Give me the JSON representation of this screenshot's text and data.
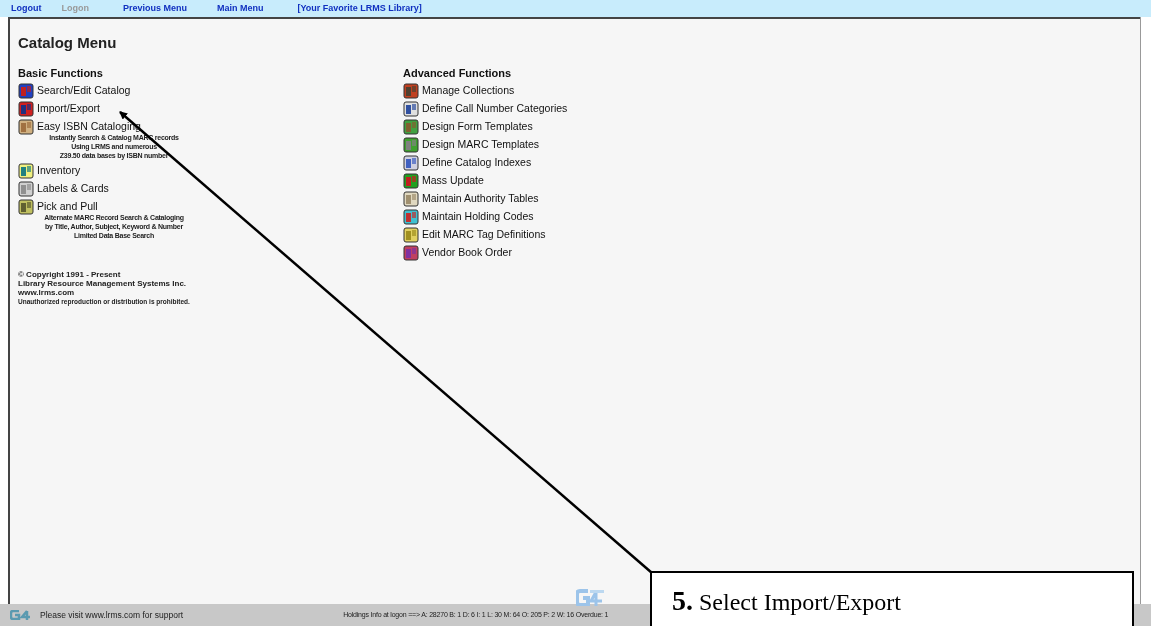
{
  "top_nav": [
    {
      "label": "Logout",
      "disabled": false
    },
    {
      "label": "Logon",
      "disabled": true
    },
    {
      "label": "Previous Menu",
      "disabled": false
    },
    {
      "label": "Main Menu",
      "disabled": false
    },
    {
      "label": "[Your Favorite LRMS Library]",
      "disabled": false
    }
  ],
  "page_title": "Catalog Menu",
  "basic_functions": {
    "heading": "Basic Functions",
    "items": [
      {
        "label": "Search/Edit Catalog"
      },
      {
        "label": "Import/Export"
      },
      {
        "label": "Easy ISBN Cataloging",
        "description": [
          "Instantly Search & Catalog MARC records",
          "Using LRMS and numerous",
          "Z39.50 data bases by ISBN number"
        ]
      },
      {
        "label": "Inventory"
      },
      {
        "label": "Labels & Cards"
      },
      {
        "label": "Pick and Pull",
        "description": [
          "Alternate MARC Record Search & Cataloging",
          "by Title, Author, Subject, Keyword & Number",
          "Limited Data Base Search"
        ]
      }
    ]
  },
  "copyright": [
    "© Copyright 1991 - Present",
    "Library Resource Management Systems Inc.",
    "www.lrms.com",
    "Unauthorized reproduction or distribution is prohibited."
  ],
  "advanced_functions": {
    "heading": "Advanced Functions",
    "items": [
      {
        "label": "Manage Collections"
      },
      {
        "label": "Define Call Number Categories"
      },
      {
        "label": "Design Form Templates"
      },
      {
        "label": "Design MARC Templates"
      },
      {
        "label": "Define Catalog Indexes"
      },
      {
        "label": "Mass Update"
      },
      {
        "label": "Maintain Authority Tables"
      },
      {
        "label": "Maintain Holding Codes"
      },
      {
        "label": "Edit MARC Tag Definitions"
      },
      {
        "label": "Vendor Book Order"
      }
    ]
  },
  "status_bar": {
    "support_text": "Please visit www.lrms.com for support",
    "holdings_text": "Holdings Info at logon ==> A: 28270 B: 1 D: 6 I: 1 L: 30 M: 64 O: 205 P: 2 W: 16  Overdue: 1"
  },
  "callout": {
    "number": "5.",
    "text": "Select Import/Export"
  }
}
